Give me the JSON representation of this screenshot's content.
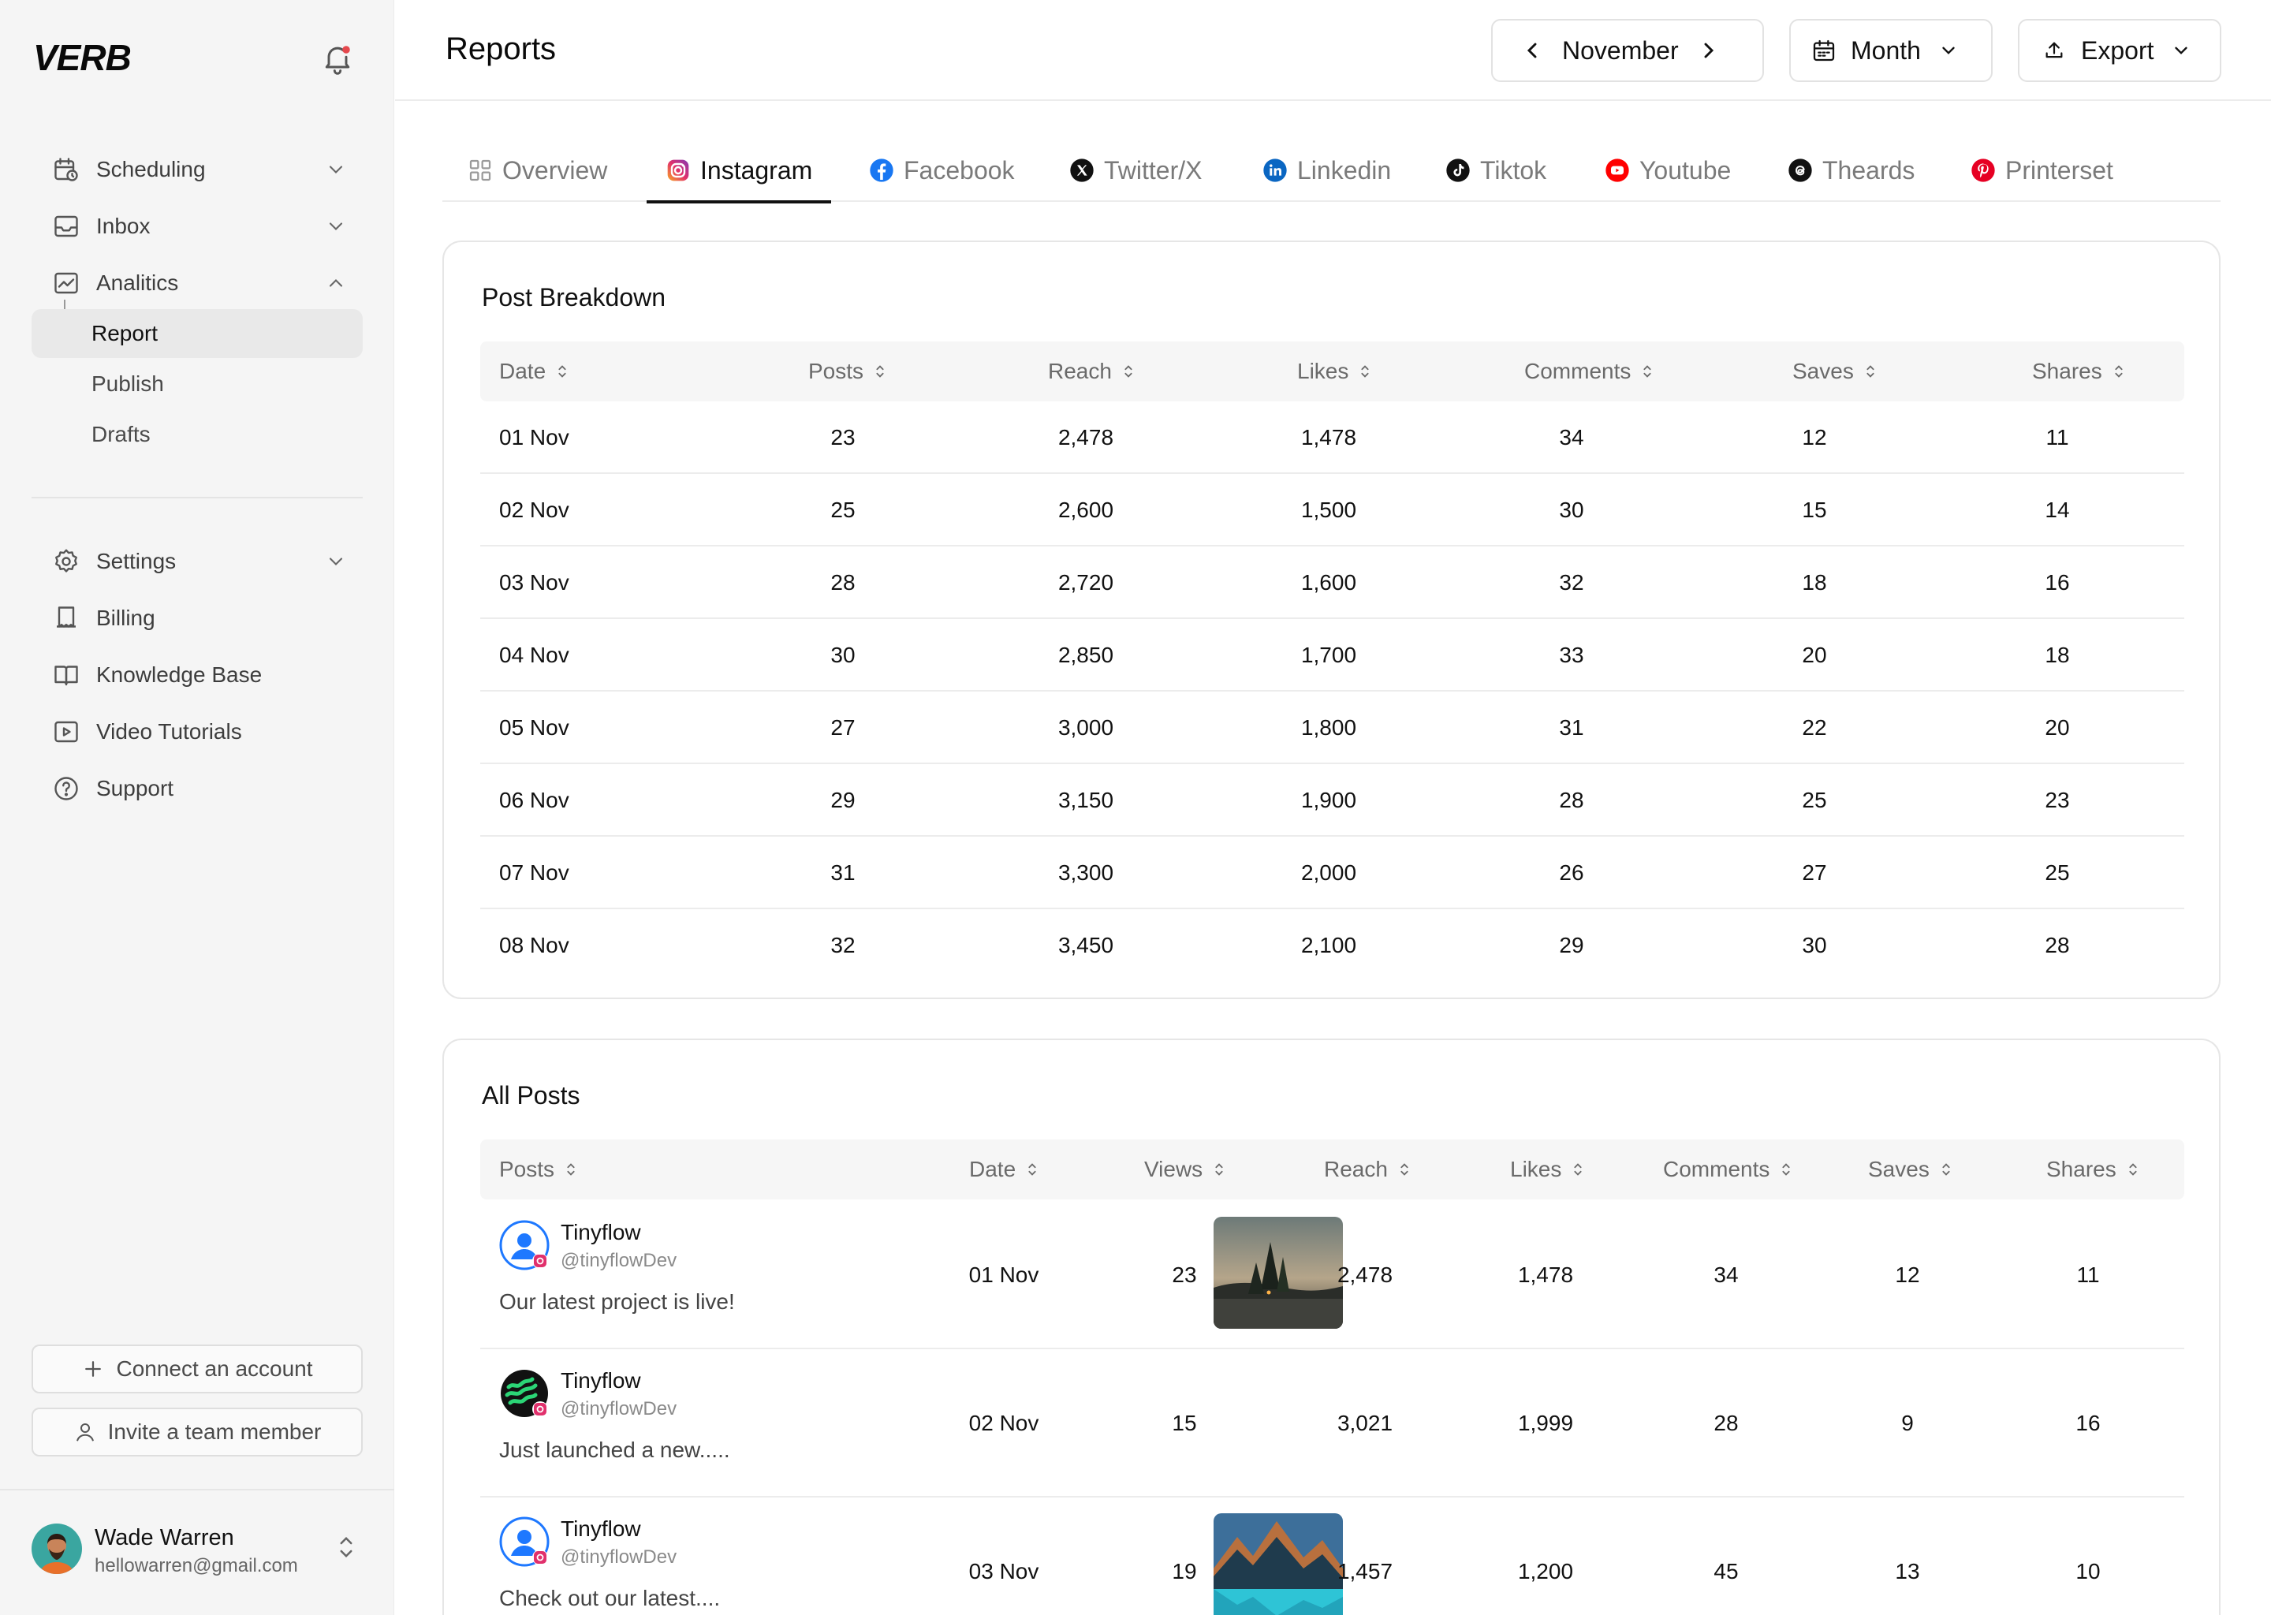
{
  "app": {
    "logo": "VERB"
  },
  "sidebar": {
    "nav": [
      {
        "label": "Scheduling",
        "icon": "calendar-clock-icon",
        "chevron": "down"
      },
      {
        "label": "Inbox",
        "icon": "inbox-icon",
        "chevron": "down"
      },
      {
        "label": "Analitics",
        "icon": "chart-line-icon",
        "chevron": "up"
      }
    ],
    "sub": [
      {
        "label": "Report",
        "active": true
      },
      {
        "label": "Publish",
        "active": false
      },
      {
        "label": "Drafts",
        "active": false
      }
    ],
    "secondary": [
      {
        "label": "Settings",
        "icon": "gear-icon",
        "chevron": "down"
      },
      {
        "label": "Billing",
        "icon": "receipt-icon"
      },
      {
        "label": "Knowledge Base",
        "icon": "book-open-icon"
      },
      {
        "label": "Video Tutorials",
        "icon": "play-square-icon"
      },
      {
        "label": "Support",
        "icon": "help-circle-icon"
      }
    ],
    "connect_label": "Connect an account",
    "invite_label": "Invite a team member",
    "user": {
      "name": "Wade Warren",
      "email": "hellowarren@gmail.com"
    }
  },
  "header": {
    "title": "Reports",
    "month": "November",
    "period": "Month",
    "export": "Export"
  },
  "tabs": [
    {
      "label": "Overview",
      "icon": "grid-icon",
      "active": false
    },
    {
      "label": "Instagram",
      "icon": "instagram-icon",
      "active": true
    },
    {
      "label": "Facebook",
      "icon": "facebook-icon",
      "active": false
    },
    {
      "label": "Twitter/X",
      "icon": "x-icon",
      "active": false
    },
    {
      "label": "Linkedin",
      "icon": "linkedin-icon",
      "active": false
    },
    {
      "label": "Tiktok",
      "icon": "tiktok-icon",
      "active": false
    },
    {
      "label": "Youtube",
      "icon": "youtube-icon",
      "active": false
    },
    {
      "label": "Theards",
      "icon": "threads-icon",
      "active": false
    },
    {
      "label": "Printerset",
      "icon": "pinterest-icon",
      "active": false
    }
  ],
  "breakdown": {
    "title": "Post Breakdown",
    "columns": [
      "Date",
      "Posts",
      "Reach",
      "Likes",
      "Comments",
      "Saves",
      "Shares"
    ],
    "rows": [
      [
        "01 Nov",
        "23",
        "2,478",
        "1,478",
        "34",
        "12",
        "11"
      ],
      [
        "02 Nov",
        "25",
        "2,600",
        "1,500",
        "30",
        "15",
        "14"
      ],
      [
        "03 Nov",
        "28",
        "2,720",
        "1,600",
        "32",
        "18",
        "16"
      ],
      [
        "04 Nov",
        "30",
        "2,850",
        "1,700",
        "33",
        "20",
        "18"
      ],
      [
        "05 Nov",
        "27",
        "3,000",
        "1,800",
        "31",
        "22",
        "20"
      ],
      [
        "06 Nov",
        "29",
        "3,150",
        "1,900",
        "28",
        "25",
        "23"
      ],
      [
        "07 Nov",
        "31",
        "3,300",
        "2,000",
        "26",
        "27",
        "25"
      ],
      [
        "08 Nov",
        "32",
        "3,450",
        "2,100",
        "29",
        "30",
        "28"
      ]
    ]
  },
  "all_posts": {
    "title": "All Posts",
    "columns": [
      "Posts",
      "Date",
      "Views",
      "Reach",
      "Likes",
      "Comments",
      "Saves",
      "Shares"
    ],
    "rows": [
      {
        "name": "Tinyflow",
        "handle": "@tinyflowDev",
        "text": "Our latest project is live!",
        "avatar": "blue-user",
        "thumb": "forest-lake",
        "date": "01 Nov",
        "views": "23",
        "reach": "2,478",
        "likes": "1,478",
        "comments": "34",
        "saves": "12",
        "shares": "11"
      },
      {
        "name": "Tinyflow",
        "handle": "@tinyflowDev",
        "text": "Just launched a new.....",
        "avatar": "green-waves",
        "thumb": "",
        "date": "02 Nov",
        "views": "15",
        "reach": "3,021",
        "likes": "1,999",
        "comments": "28",
        "saves": "9",
        "shares": "16"
      },
      {
        "name": "Tinyflow",
        "handle": "@tinyflowDev",
        "text": "Check out our latest....",
        "avatar": "blue-user",
        "thumb": "mountain-lake",
        "date": "03 Nov",
        "views": "19",
        "reach": "1,457",
        "likes": "1,200",
        "comments": "45",
        "saves": "13",
        "shares": "10"
      }
    ]
  }
}
